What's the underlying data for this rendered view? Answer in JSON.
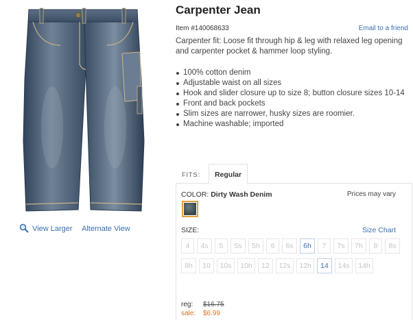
{
  "product": {
    "title": "Carpenter Jean",
    "item_number": "Item #140068633",
    "email_link": "Email to a friend",
    "description": "Carpenter fit: Loose fit through hip & leg with relaxed leg opening and carpenter pocket & hammer loop styling.",
    "features": [
      "100% cotton denim",
      "Adjustable waist on all sizes",
      "Hook and slider closure up to size 8; button closure sizes 10-14",
      "Front and back pockets",
      "Slim sizes are narrower, husky sizes are roomier.",
      "Machine washable; imported"
    ]
  },
  "image_links": {
    "view_larger": "View Larger",
    "alternate_view": "Alternate View"
  },
  "fits": {
    "label": "FITS:",
    "tabs": [
      {
        "label": "Regular",
        "selected": true
      }
    ]
  },
  "color": {
    "label": "COLOR:",
    "value": "Dirty Wash Denim",
    "prices_note": "Prices may vary"
  },
  "size": {
    "label": "SIZE:",
    "chart_link": "Size Chart",
    "options": [
      {
        "label": "4",
        "available": false
      },
      {
        "label": "4s",
        "available": false
      },
      {
        "label": "5",
        "available": false
      },
      {
        "label": "5s",
        "available": false
      },
      {
        "label": "5h",
        "available": false
      },
      {
        "label": "6",
        "available": false
      },
      {
        "label": "6s",
        "available": false
      },
      {
        "label": "6h",
        "available": true
      },
      {
        "label": "7",
        "available": false
      },
      {
        "label": "7s",
        "available": false
      },
      {
        "label": "7h",
        "available": false
      },
      {
        "label": "8",
        "available": false
      },
      {
        "label": "8s",
        "available": false
      },
      {
        "label": "8h",
        "available": false
      },
      {
        "label": "10",
        "available": false
      },
      {
        "label": "10s",
        "available": false
      },
      {
        "label": "10h",
        "available": false
      },
      {
        "label": "12",
        "available": false
      },
      {
        "label": "12s",
        "available": false
      },
      {
        "label": "12h",
        "available": false
      },
      {
        "label": "14",
        "available": true
      },
      {
        "label": "14s",
        "available": false
      },
      {
        "label": "14h",
        "available": false
      }
    ]
  },
  "pricing": {
    "reg_label": "reg:",
    "reg_value": "$16.75",
    "sale_label": "sale:",
    "sale_value": "$6.99"
  },
  "colors": {
    "link": "#3a6fb0",
    "sale": "#d9731c",
    "swatch_border": "#e2a13a",
    "unavailable_text": "#c4c4c4"
  },
  "icons": {
    "zoom": "magnifier-icon",
    "bullet": "bullet-dot"
  }
}
